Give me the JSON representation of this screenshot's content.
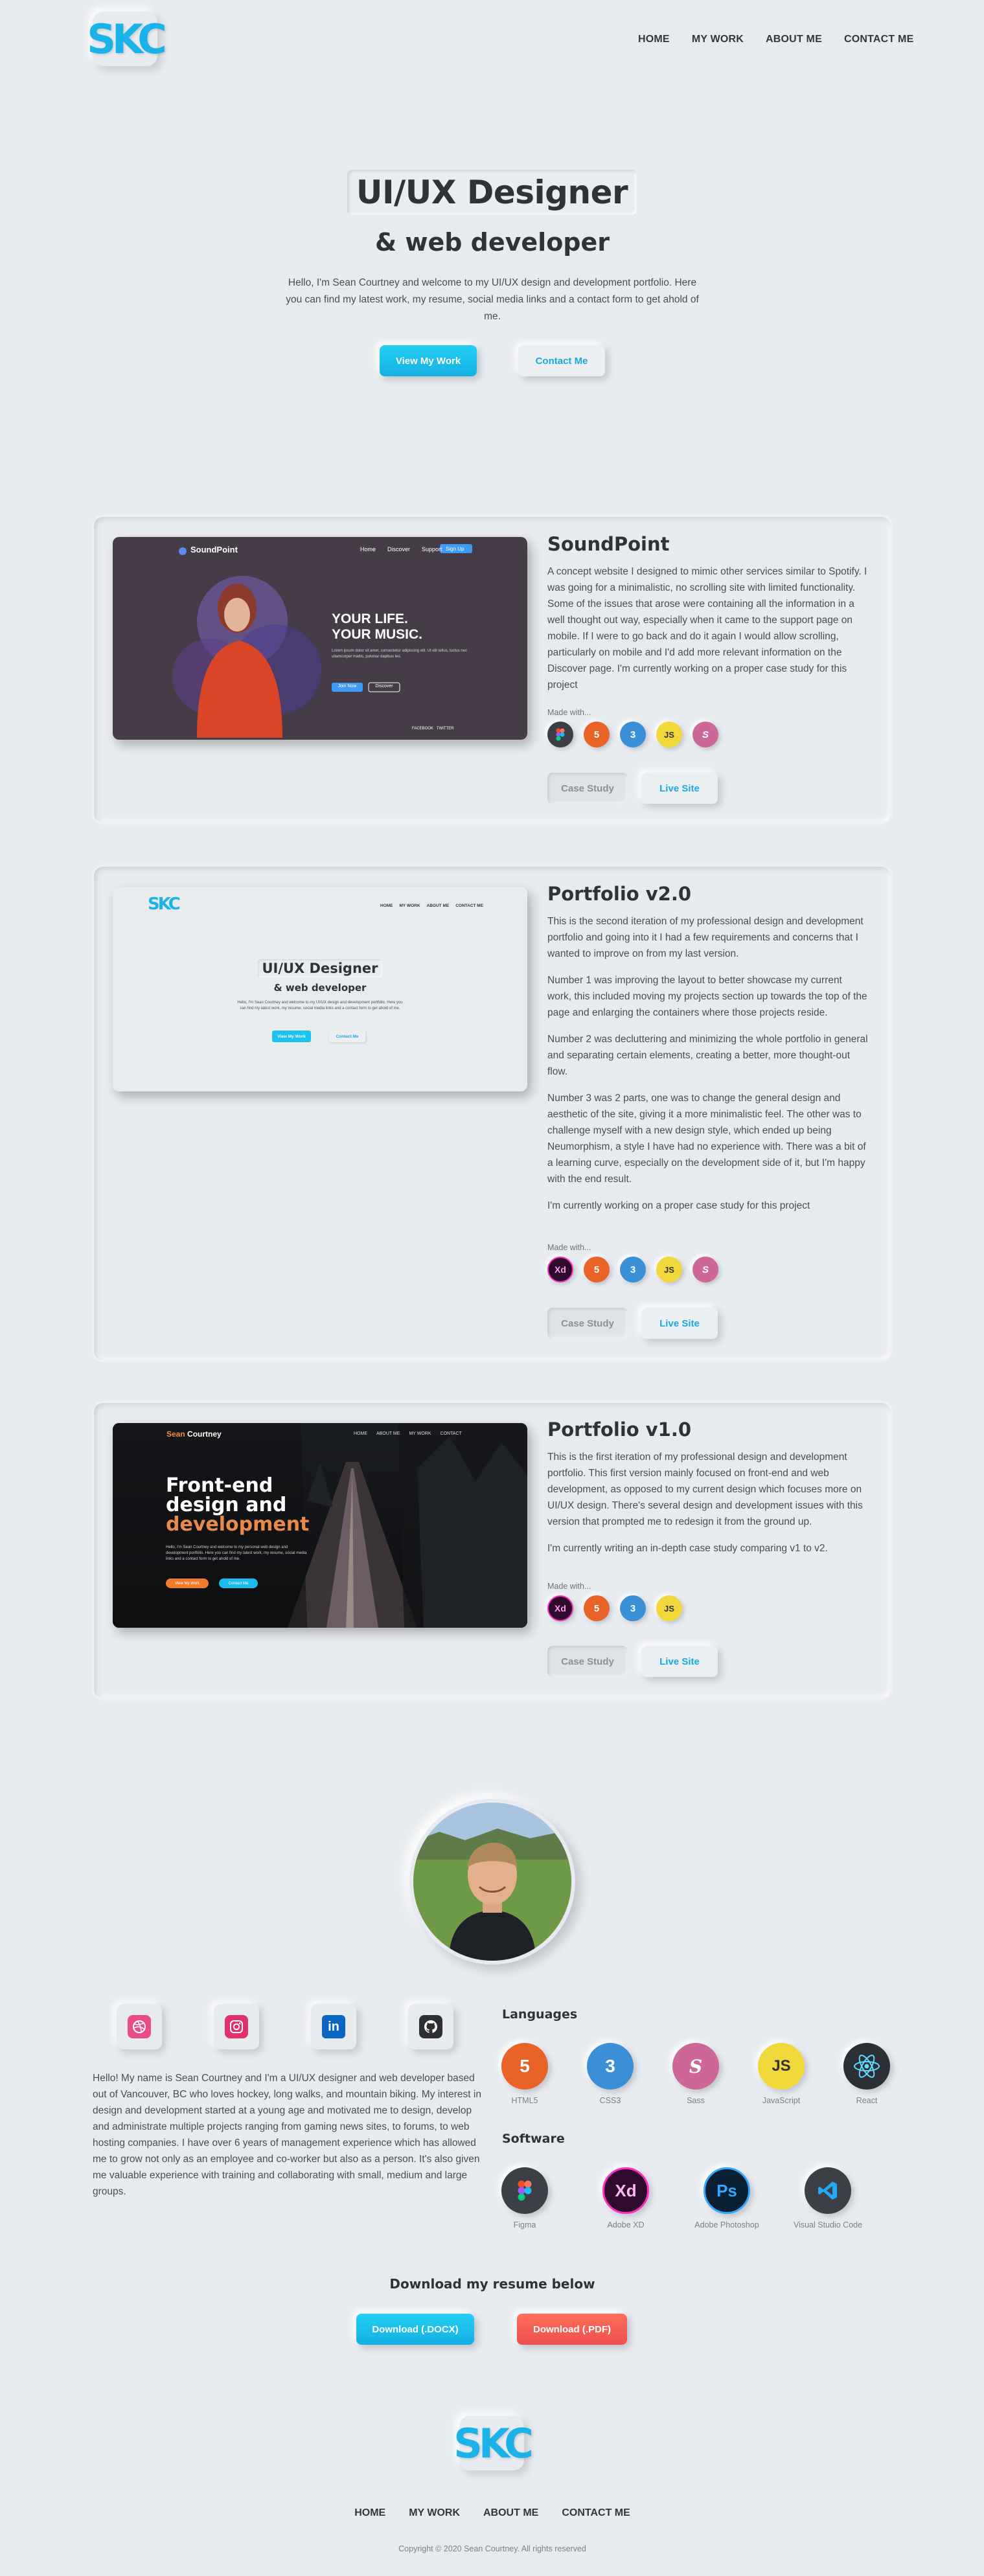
{
  "header": {
    "logo": "SKC",
    "nav": [
      "HOME",
      "MY WORK",
      "ABOUT ME",
      "CONTACT ME"
    ]
  },
  "hero": {
    "title": "UI/UX Designer",
    "subtitle": "& web developer",
    "intro": "Hello, I'm Sean Courtney and welcome to my UI/UX design and development portfolio. Here you can find my latest work, my resume, social media links and a contact form to get ahold of me.",
    "btn_work": "View My Work",
    "btn_contact": "Contact Me"
  },
  "projects": [
    {
      "title": "SoundPoint",
      "paragraphs": [
        "A concept website I designed to mimic other services similar to Spotify. I was going for a minimalistic, no scrolling site with limited functionality. Some of the issues that arose were containing all the information in a well thought out way, especially when it came to the support page on mobile. If I were to go back and do it again I would allow scrolling, particularly on mobile and I'd add more relevant information on the Discover page. I'm currently working on a proper case study for this project"
      ],
      "made_with": "Made with...",
      "tools": [
        "figma-icon",
        "html5-icon",
        "css3-icon",
        "javascript-icon",
        "sass-icon"
      ],
      "btn_case": "Case Study",
      "btn_live": "Live Site",
      "shot": {
        "brand": "SoundPoint",
        "nav": [
          "Home",
          "Discover",
          "Support"
        ],
        "cta": "Sign Up",
        "headline_1": "YOUR LIFE.",
        "headline_2": "YOUR MUSIC.",
        "body": "Lorem ipsum dolor sit amet, consectetur adipiscing elit. Ut elit tellus, luctus nec ullamcorper mattis, pulvinar dapibus leo.",
        "btn_a": "Join Now",
        "btn_b": "Discover",
        "social": "FACEBOOK   TWITTER"
      }
    },
    {
      "title": "Portfolio v2.0",
      "paragraphs": [
        "This is the second iteration of my professional design and development portfolio and going into it I had a few requirements and concerns that I wanted to improve on from my last version.",
        "Number 1 was improving the layout to better showcase my current work, this included moving my projects section up towards the top of the page and enlarging the containers where those projects reside.",
        "Number 2 was decluttering and minimizing the whole portfolio in general and separating certain elements, creating a better, more thought-out flow.",
        "Number 3 was 2 parts, one was to change the general design and aesthetic of the site, giving it a more minimalistic feel. The other was to challenge myself with a new design style, which ended up being Neumorphism, a style I have had no experience with. There was a bit of a learning curve, especially on the development side of it, but I'm happy with the end result.",
        "I'm currently working on a proper case study for this project"
      ],
      "made_with": "Made with...",
      "tools": [
        "adobe-xd-icon",
        "html5-icon",
        "css3-icon",
        "javascript-icon",
        "sass-icon"
      ],
      "btn_case": "Case Study",
      "btn_live": "Live Site",
      "shot": {
        "logo": "SKC",
        "nav": [
          "HOME",
          "MY WORK",
          "ABOUT ME",
          "CONTACT ME"
        ],
        "title": "UI/UX Designer",
        "subtitle": "& web developer",
        "intro": "Hello, I'm Sean Courtney and welcome to my UI/UX design and development portfolio. Here you can find my latest work, my resume, social media links and a contact form to get ahold of me.",
        "btn_a": "View My Work",
        "btn_b": "Contact Me"
      }
    },
    {
      "title": "Portfolio v1.0",
      "paragraphs": [
        "This is the first iteration of my professional design and development portfolio. This first version mainly focused on front-end and web development, as opposed to my current design which focuses more on UI/UX design. There's several design and development issues with this version that prompted me to redesign it from the ground up.",
        "I'm currently writing an in-depth case study comparing v1 to v2."
      ],
      "made_with": "Made with...",
      "tools": [
        "adobe-xd-icon",
        "html5-icon",
        "css3-icon",
        "javascript-icon"
      ],
      "btn_case": "Case Study",
      "btn_live": "Live Site",
      "shot": {
        "brand_a": "Sean",
        "brand_b": "Courtney",
        "nav": [
          "HOME",
          "ABOUT ME",
          "MY WORK",
          "CONTACT"
        ],
        "line_1": "Front-end",
        "line_2": "design and",
        "line_3": "development",
        "body": "Hello, I'm Sean Courtney and welcome to my personal web design and development portfolio. Here you can find my latest work, my resume, social media links and a contact form to get ahold of me.",
        "btn_a": "View My Work",
        "btn_b": "Contact Me"
      }
    }
  ],
  "about": {
    "socials": [
      "dribbble-icon",
      "instagram-icon",
      "linkedin-icon",
      "github-icon"
    ],
    "text": "Hello! My name is Sean Courtney and I'm a UI/UX designer and web developer based out of Vancouver, BC who loves hockey, long walks, and mountain biking. My interest in design and development started at a young age and motivated me to design, develop and administrate multiple projects ranging from gaming news sites, to forums, to web hosting companies. I have over 6 years of management experience which has allowed me to grow not only as an employee and co-worker but also as a person. It's also given me valuable experience with training and collaborating with small, medium and large groups.",
    "languages_title": "Languages",
    "languages": [
      {
        "label": "HTML5",
        "icon": "html5-icon",
        "color": "#e96228"
      },
      {
        "label": "CSS3",
        "icon": "css3-icon",
        "color": "#3b8fd6"
      },
      {
        "label": "Sass",
        "icon": "sass-icon",
        "color": "#cd6799"
      },
      {
        "label": "JavaScript",
        "icon": "javascript-icon",
        "color": "#f0d83a"
      },
      {
        "label": "React",
        "icon": "react-icon",
        "color": "#2b2f36"
      }
    ],
    "software_title": "Software",
    "software": [
      {
        "label": "Figma",
        "icon": "figma-icon",
        "color": "#3c3f46"
      },
      {
        "label": "Adobe XD",
        "icon": "adobe-xd-icon",
        "color": "#2e0a2c"
      },
      {
        "label": "Adobe Photoshop",
        "icon": "photoshop-icon",
        "color": "#0b1f33"
      },
      {
        "label": "Visual Studio Code",
        "icon": "vscode-icon",
        "color": "#3c3f46"
      }
    ]
  },
  "resume": {
    "title": "Download my resume below",
    "btn_docx": "Download (.DOCX)",
    "btn_pdf": "Download (.PDF)"
  },
  "footer": {
    "logo": "SKC",
    "nav": [
      "HOME",
      "MY WORK",
      "ABOUT ME",
      "CONTACT ME"
    ],
    "copyright": "Copyright © 2020 Sean Courtney. All rights reserved"
  }
}
